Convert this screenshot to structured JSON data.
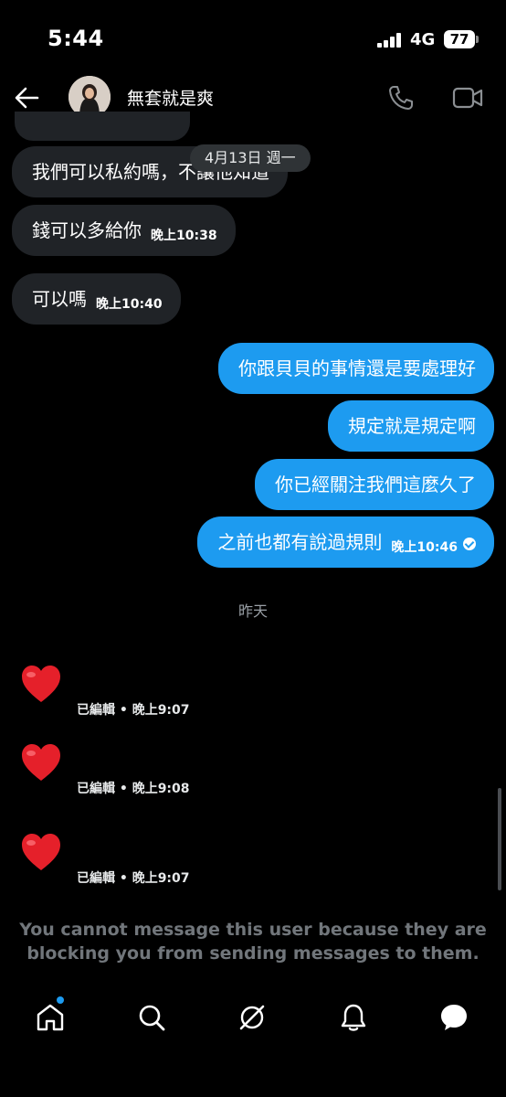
{
  "status_bar": {
    "time": "5:44",
    "network": "4G",
    "battery": "77"
  },
  "header": {
    "contact_name": "無套就是爽"
  },
  "date_pill": "4月13日 週一",
  "messages_in": [
    {
      "text": "我們可以私約嗎，不讓他知道",
      "time": ""
    },
    {
      "text": "錢可以多給你",
      "time": "晚上10:38"
    },
    {
      "text": "可以嗎",
      "time": "晚上10:40"
    }
  ],
  "messages_out": [
    {
      "text": "你跟貝貝的事情還是要處理好",
      "time": ""
    },
    {
      "text": "規定就是規定啊",
      "time": ""
    },
    {
      "text": "你已經關注我們這麼久了",
      "time": ""
    },
    {
      "text": "之前也都有說過規則",
      "time": "晚上10:46"
    }
  ],
  "day_divider": "昨天",
  "reactions": [
    {
      "emoji": "heart",
      "meta": "已編輯 • 晚上9:07"
    },
    {
      "emoji": "heart",
      "meta": "已編輯 • 晚上9:08"
    },
    {
      "emoji": "heart",
      "meta": "已編輯 • 晚上9:07"
    }
  ],
  "blocked_notice": {
    "line1": "You cannot message this user because they are",
    "line2": "blocking you from sending messages to them."
  },
  "nav": [
    "home-icon",
    "search-icon",
    "grok-icon",
    "bell-icon",
    "messages-icon"
  ],
  "colors": {
    "accent": "#1d9bf0",
    "incoming_bubble": "#202327",
    "muted": "#71767b"
  }
}
